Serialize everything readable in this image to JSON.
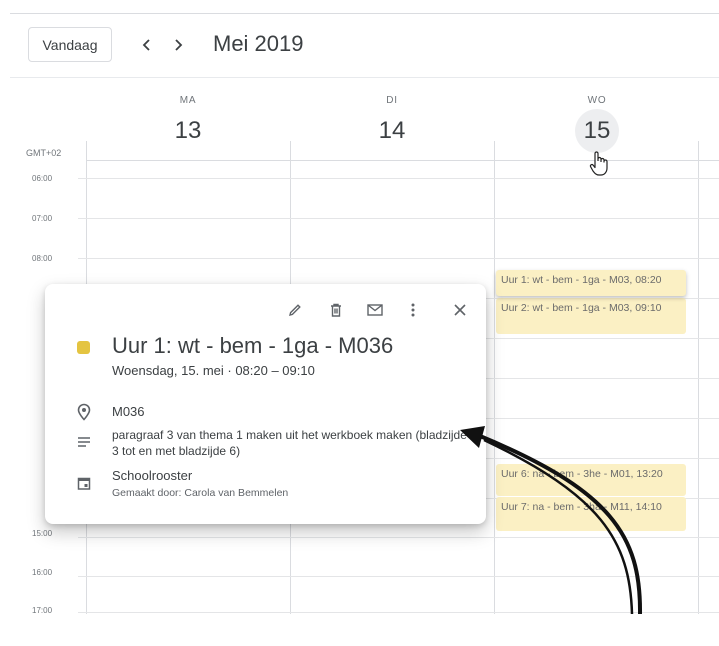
{
  "toolbar": {
    "today_label": "Vandaag",
    "prev_label": "<",
    "next_label": ">",
    "month_label": "Mei 2019"
  },
  "days": [
    {
      "dow": "MA",
      "num": "13"
    },
    {
      "dow": "DI",
      "num": "14"
    },
    {
      "dow": "WO",
      "num": "15"
    }
  ],
  "timezone": "GMT+02",
  "hours": [
    "06:00",
    "07:00",
    "08:00",
    "15:00",
    "16:00",
    "17:00"
  ],
  "events": [
    {
      "title": "Uur 1: wt - bem - 1ga - M03,",
      "time": "08:20"
    },
    {
      "title": "Uur 2: wt - bem - 1ga - M03,",
      "time": "09:10"
    },
    {
      "title": "Uur 6: na - bem - 3he - M01,",
      "time": "13:20"
    },
    {
      "title": "Uur 7: na - bem - 3ha - M11,",
      "time": "14:10"
    }
  ],
  "popup": {
    "title": "Uur 1: wt - bem - 1ga - M036",
    "date_time": "Woensdag, 15. mei  ·  08:20 – 09:10",
    "location": "M036",
    "description": "paragraaf 3 van thema 1 maken uit het werkboek maken (bladzijde 3 tot en met bladzijde 6)",
    "calendar": "Schoolrooster",
    "creator": "Gemaakt door: Carola van Bemmelen",
    "color": "#e4c441"
  },
  "colors": {
    "event_bg": "#fbf0c4",
    "today_circle": "#edeef0",
    "gridline": "#dadce0"
  },
  "icons": [
    "pencil-icon",
    "trash-icon",
    "mail-icon",
    "more-vert-icon",
    "close-icon",
    "location-pin-icon",
    "description-icon",
    "calendar-icon",
    "hand-cursor-icon",
    "curved-arrow"
  ]
}
